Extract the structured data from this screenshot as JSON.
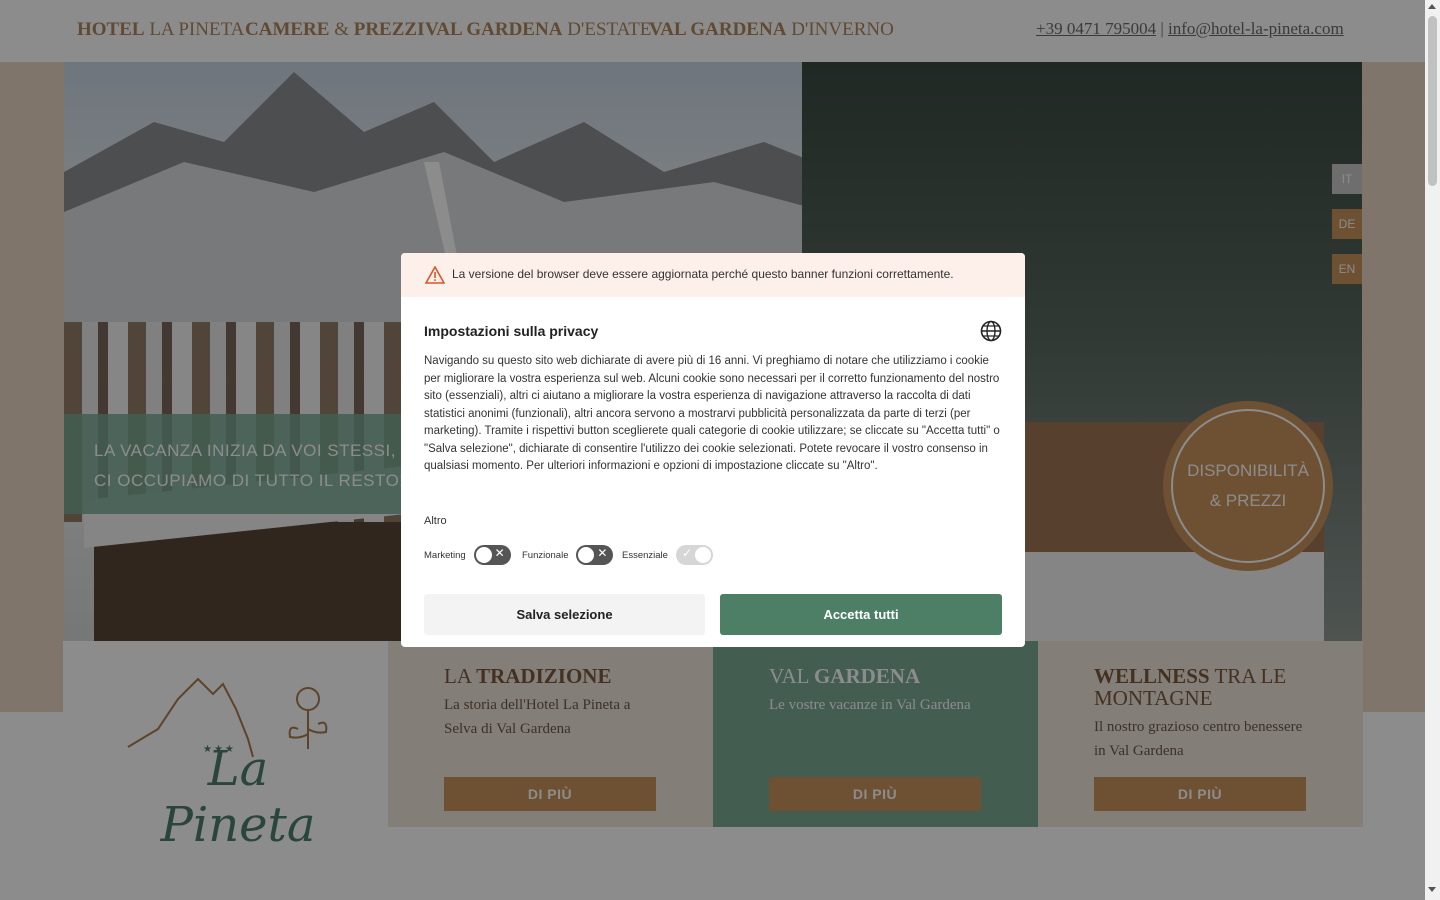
{
  "nav": {
    "items": [
      {
        "strong": "HOTEL",
        "light": "La Pineta"
      },
      {
        "strong": "CAMERE",
        "amp": "&",
        "strong2": "PREZZI"
      },
      {
        "strong": "VAL GARDENA",
        "light": "d'estate"
      },
      {
        "strong": "VAL GARDENA",
        "light": "d'inverno"
      }
    ],
    "phone": "+39 0471 795004",
    "separator": "|",
    "email": "info@hotel-la-pineta.com"
  },
  "hero": {
    "tagline_line1": "LA VACANZA INIZIA DA VOI STESSI, NOI",
    "tagline_line2": "CI OCCUPIAMO DI TUTTO IL RESTO!",
    "availability_line1": "DISPONIBILITÀ",
    "availability_line2": "& PREZZI"
  },
  "languages": [
    "IT",
    "DE",
    "EN"
  ],
  "cards": [
    {
      "title_light": "La",
      "title_strong": "TRADIZIONE",
      "text": "La storia dell'Hotel La Pineta a Selva di Val Gardena",
      "button": "DI PIÙ"
    },
    {
      "title_light": "Val",
      "title_strong": "GARDENA",
      "text": "Le vostre vacanze in Val Gardena",
      "button": "DI PIÙ"
    },
    {
      "title_strong": "WELLNESS",
      "title_light": "tra le montagne",
      "text": "Il nostro grazioso centro benessere in Val Gardena",
      "button": "DI PIÙ"
    }
  ],
  "logo": {
    "stars": "★★★",
    "name": "La Pineta"
  },
  "consent": {
    "warning": "La versione del browser deve essere aggiornata perché questo banner funzioni correttamente.",
    "title": "Impostazioni sulla privacy",
    "body": "Navigando su questo sito web dichiarate di avere più di 16 anni. Vi preghiamo di notare che utilizziamo i cookie per migliorare la vostra esperienza sul web. Alcuni cookie sono necessari per il corretto funzionamento del nostro sito (essenziali), altri ci aiutano a migliorare la vostra esperienza di navigazione attraverso la raccolta di dati statistici anonimi (funzionali), altri ancora servono a mostrarvi pubblicità personalizzata da parte di terzi (per marketing). Tramite i rispettivi button sceglierete quali categorie di cookie utilizzare; se cliccate su \"Accetta tutti\" o \"Salva selezione\", dichiarate di consentire l'utilizzo dei cookie selezionati. Potete revocare il vostro consenso in qualsiasi momento. Per ulteriori informazioni e opzioni di impostazione cliccate su \"Altro\".",
    "more_link": "Altro",
    "toggles": [
      {
        "label": "Marketing",
        "state": "off"
      },
      {
        "label": "Funzionale",
        "state": "off"
      },
      {
        "label": "Essenziale",
        "state": "on"
      }
    ],
    "save_button": "Salva selezione",
    "accept_button": "Accetta tutti"
  },
  "colors": {
    "accent_brown": "#c8935c",
    "accent_green": "#4d7f66",
    "card_green": "#7aaa94"
  }
}
